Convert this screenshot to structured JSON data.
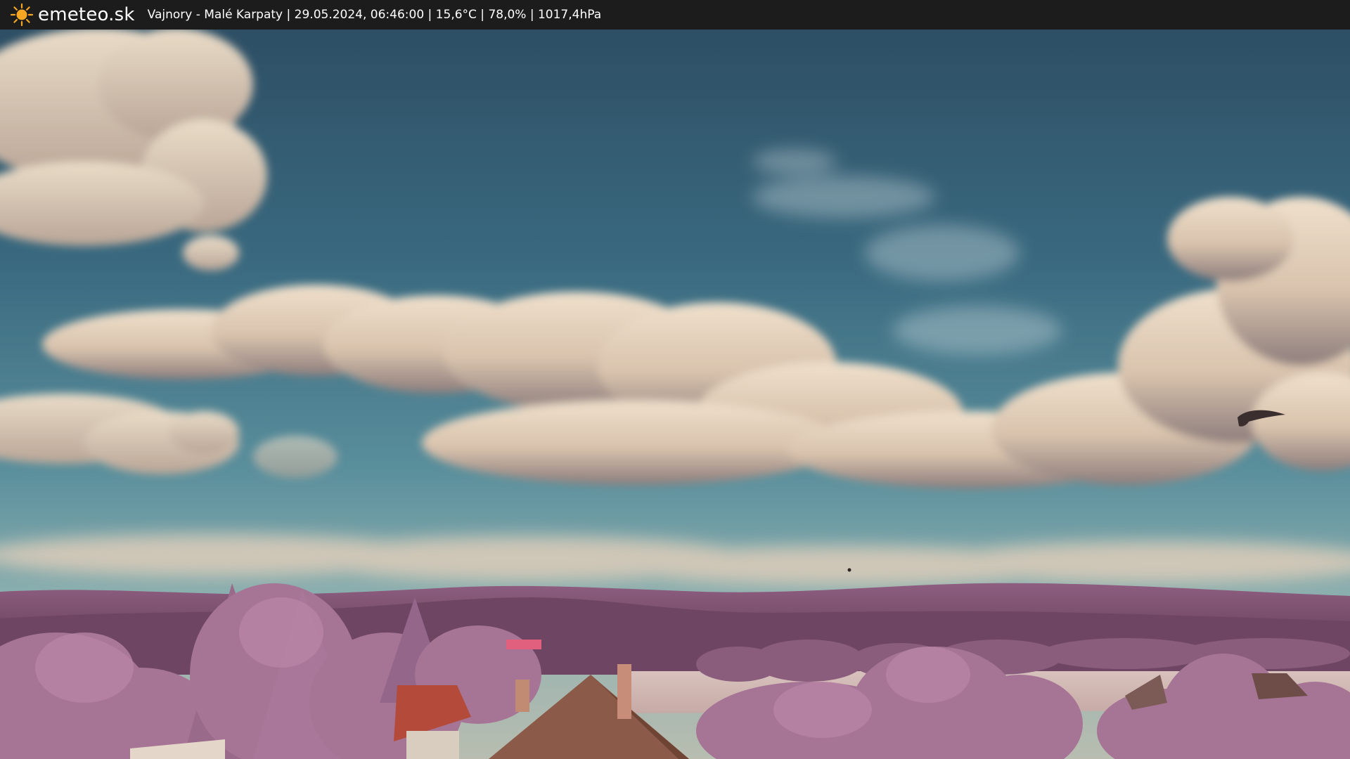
{
  "header": {
    "logo_text": "emeteo.sk",
    "logo_icon": "sun-icon",
    "station_info": "Vajnory - Malé Karpaty | 29.05.2024, 06:46:00 | 15,6°C | 78,0% | 1017,4hPa"
  },
  "colors": {
    "bar_background": "#1c1c1c",
    "sun": "#f5a623",
    "sky_top": "#2e4d63",
    "sky_horizon": "#6f9ea6",
    "foliage": "#a0708f",
    "hills": "#7e4f70",
    "cloud": "#e6d3be"
  }
}
